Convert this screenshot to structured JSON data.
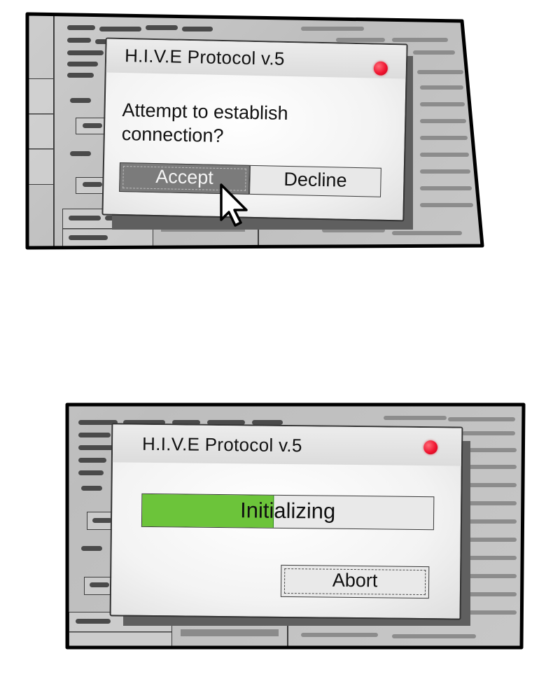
{
  "panels": [
    {
      "dialog": {
        "title": "H.I.V.E Protocol v.5",
        "close_icon": "close-dot-icon",
        "prompt_line1": "Attempt to establish",
        "prompt_line2": "connection?",
        "accept_label": "Accept",
        "decline_label": "Decline"
      },
      "cursor_icon": "arrow-cursor-icon"
    },
    {
      "dialog": {
        "title": "H.I.V.E Protocol v.5",
        "close_icon": "close-dot-icon",
        "progress_label": "Initializing",
        "progress_fraction": 0.45,
        "abort_label": "Abort"
      }
    }
  ],
  "colors": {
    "close_dot": "#f01530",
    "progress_fill": "#6cc43a",
    "accept_button": "#7b7b7b"
  }
}
